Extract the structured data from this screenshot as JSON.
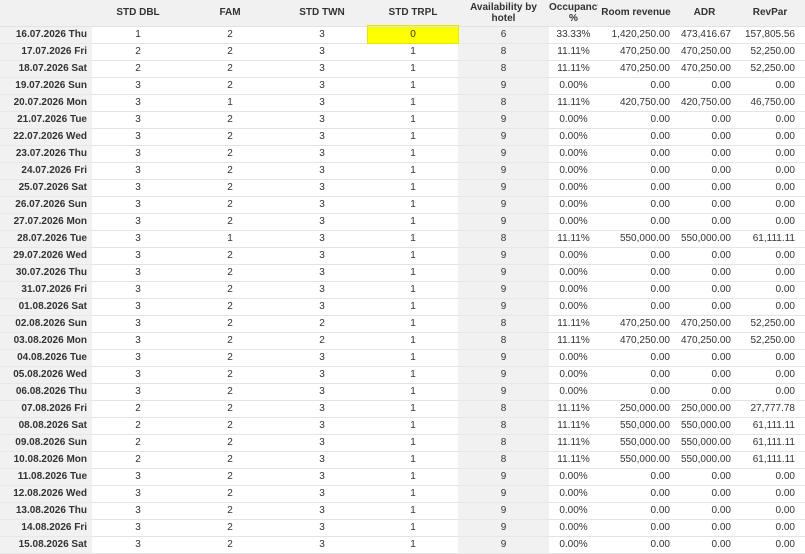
{
  "columns": {
    "std_dbl": "STD DBL",
    "fam": "FAM",
    "std_twn": "STD TWN",
    "std_trpl": "STD TRPL",
    "availability": "Availability by hotel",
    "occupancy": "Occupancy %",
    "room_revenue": "Room revenue",
    "adr": "ADR",
    "revpar": "RevPar"
  },
  "highlight": {
    "row": 0,
    "column": "std_trpl",
    "color": "#ffff00"
  },
  "rows": [
    [
      "16.07.2026 Thu",
      "1",
      "2",
      "3",
      "0",
      "6",
      "33.33%",
      "1,420,250.00",
      "473,416.67",
      "157,805.56"
    ],
    [
      "17.07.2026 Fri",
      "2",
      "2",
      "3",
      "1",
      "8",
      "11.11%",
      "470,250.00",
      "470,250.00",
      "52,250.00"
    ],
    [
      "18.07.2026 Sat",
      "2",
      "2",
      "3",
      "1",
      "8",
      "11.11%",
      "470,250.00",
      "470,250.00",
      "52,250.00"
    ],
    [
      "19.07.2026 Sun",
      "3",
      "2",
      "3",
      "1",
      "9",
      "0.00%",
      "0.00",
      "0.00",
      "0.00"
    ],
    [
      "20.07.2026 Mon",
      "3",
      "1",
      "3",
      "1",
      "8",
      "11.11%",
      "420,750.00",
      "420,750.00",
      "46,750.00"
    ],
    [
      "21.07.2026 Tue",
      "3",
      "2",
      "3",
      "1",
      "9",
      "0.00%",
      "0.00",
      "0.00",
      "0.00"
    ],
    [
      "22.07.2026 Wed",
      "3",
      "2",
      "3",
      "1",
      "9",
      "0.00%",
      "0.00",
      "0.00",
      "0.00"
    ],
    [
      "23.07.2026 Thu",
      "3",
      "2",
      "3",
      "1",
      "9",
      "0.00%",
      "0.00",
      "0.00",
      "0.00"
    ],
    [
      "24.07.2026 Fri",
      "3",
      "2",
      "3",
      "1",
      "9",
      "0.00%",
      "0.00",
      "0.00",
      "0.00"
    ],
    [
      "25.07.2026 Sat",
      "3",
      "2",
      "3",
      "1",
      "9",
      "0.00%",
      "0.00",
      "0.00",
      "0.00"
    ],
    [
      "26.07.2026 Sun",
      "3",
      "2",
      "3",
      "1",
      "9",
      "0.00%",
      "0.00",
      "0.00",
      "0.00"
    ],
    [
      "27.07.2026 Mon",
      "3",
      "2",
      "3",
      "1",
      "9",
      "0.00%",
      "0.00",
      "0.00",
      "0.00"
    ],
    [
      "28.07.2026 Tue",
      "3",
      "1",
      "3",
      "1",
      "8",
      "11.11%",
      "550,000.00",
      "550,000.00",
      "61,111.11"
    ],
    [
      "29.07.2026 Wed",
      "3",
      "2",
      "3",
      "1",
      "9",
      "0.00%",
      "0.00",
      "0.00",
      "0.00"
    ],
    [
      "30.07.2026 Thu",
      "3",
      "2",
      "3",
      "1",
      "9",
      "0.00%",
      "0.00",
      "0.00",
      "0.00"
    ],
    [
      "31.07.2026 Fri",
      "3",
      "2",
      "3",
      "1",
      "9",
      "0.00%",
      "0.00",
      "0.00",
      "0.00"
    ],
    [
      "01.08.2026 Sat",
      "3",
      "2",
      "3",
      "1",
      "9",
      "0.00%",
      "0.00",
      "0.00",
      "0.00"
    ],
    [
      "02.08.2026 Sun",
      "3",
      "2",
      "2",
      "1",
      "8",
      "11.11%",
      "470,250.00",
      "470,250.00",
      "52,250.00"
    ],
    [
      "03.08.2026 Mon",
      "3",
      "2",
      "2",
      "1",
      "8",
      "11.11%",
      "470,250.00",
      "470,250.00",
      "52,250.00"
    ],
    [
      "04.08.2026 Tue",
      "3",
      "2",
      "3",
      "1",
      "9",
      "0.00%",
      "0.00",
      "0.00",
      "0.00"
    ],
    [
      "05.08.2026 Wed",
      "3",
      "2",
      "3",
      "1",
      "9",
      "0.00%",
      "0.00",
      "0.00",
      "0.00"
    ],
    [
      "06.08.2026 Thu",
      "3",
      "2",
      "3",
      "1",
      "9",
      "0.00%",
      "0.00",
      "0.00",
      "0.00"
    ],
    [
      "07.08.2026 Fri",
      "2",
      "2",
      "3",
      "1",
      "8",
      "11.11%",
      "250,000.00",
      "250,000.00",
      "27,777.78"
    ],
    [
      "08.08.2026 Sat",
      "2",
      "2",
      "3",
      "1",
      "8",
      "11.11%",
      "550,000.00",
      "550,000.00",
      "61,111.11"
    ],
    [
      "09.08.2026 Sun",
      "2",
      "2",
      "3",
      "1",
      "8",
      "11.11%",
      "550,000.00",
      "550,000.00",
      "61,111.11"
    ],
    [
      "10.08.2026 Mon",
      "2",
      "2",
      "3",
      "1",
      "8",
      "11.11%",
      "550,000.00",
      "550,000.00",
      "61,111.11"
    ],
    [
      "11.08.2026 Tue",
      "3",
      "2",
      "3",
      "1",
      "9",
      "0.00%",
      "0.00",
      "0.00",
      "0.00"
    ],
    [
      "12.08.2026 Wed",
      "3",
      "2",
      "3",
      "1",
      "9",
      "0.00%",
      "0.00",
      "0.00",
      "0.00"
    ],
    [
      "13.08.2026 Thu",
      "3",
      "2",
      "3",
      "1",
      "9",
      "0.00%",
      "0.00",
      "0.00",
      "0.00"
    ],
    [
      "14.08.2026 Fri",
      "3",
      "2",
      "3",
      "1",
      "9",
      "0.00%",
      "0.00",
      "0.00",
      "0.00"
    ],
    [
      "15.08.2026 Sat",
      "3",
      "2",
      "3",
      "1",
      "9",
      "0.00%",
      "0.00",
      "0.00",
      "0.00"
    ]
  ]
}
